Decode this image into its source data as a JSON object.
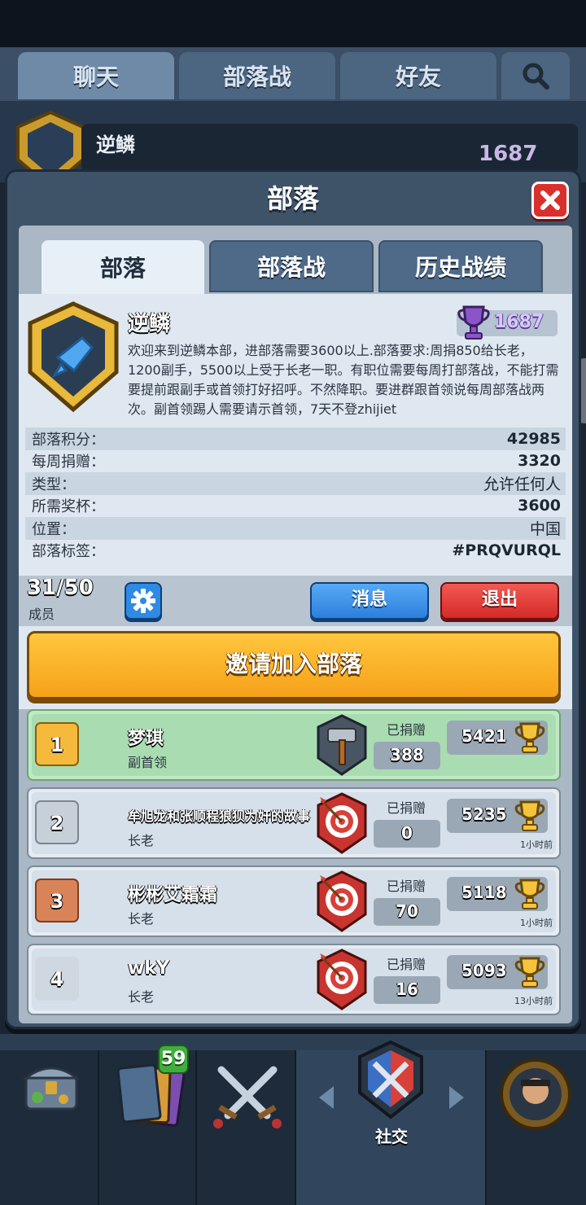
{
  "top_tabs": [
    "聊天",
    "部落战",
    "好友"
  ],
  "background_clan": {
    "name": "逆鳞",
    "trophies": "1687"
  },
  "modal": {
    "title": "部落",
    "tabs": [
      "部落",
      "部落战",
      "历史战绩"
    ],
    "clan": {
      "name": "逆鳞",
      "trophies": "1687",
      "description": "欢迎来到逆鳞本部，进部落需要3600以上.部落要求:周捐850给长老，1200副手，5500以上受于长老一职。有职位需要每周打部落战，不能打需要提前跟副手或首领打好招呼。不然降职。要进群跟首领说每周部落战两次。副首领踢人需要请示首领，7天不登zhijiet"
    },
    "stats": [
      {
        "label": "部落积分：",
        "value": "42985"
      },
      {
        "label": "每周捐赠：",
        "value": "3320"
      },
      {
        "label": "类型：",
        "value": "允许任何人"
      },
      {
        "label": "所需奖杯：",
        "value": "3600"
      },
      {
        "label": "位置：",
        "value": "中国"
      },
      {
        "label": "部落标签：",
        "value": "#PRQVURQL"
      }
    ],
    "members_count": "31/50",
    "members_label": "成员",
    "message_button": "消息",
    "leave_button": "退出",
    "invite_button": "邀请加入部落",
    "donated_label": "已捐赠",
    "members": [
      {
        "rank": "1",
        "name": "梦琪",
        "role": "副首领",
        "donated": "388",
        "trophies": "5421",
        "last_seen": ""
      },
      {
        "rank": "2",
        "name": "牟旭龙和张顺程狼狈为奸的故事",
        "role": "长老",
        "donated": "0",
        "trophies": "5235",
        "last_seen": "1小时前"
      },
      {
        "rank": "3",
        "name": "彬彬艾霜霜",
        "role": "长老",
        "donated": "70",
        "trophies": "5118",
        "last_seen": "1小时前"
      },
      {
        "rank": "4",
        "name": "wkY",
        "role": "长老",
        "donated": "16",
        "trophies": "5093",
        "last_seen": "13小时前"
      }
    ]
  },
  "bottom_nav": {
    "cards_badge": "59",
    "social_label": "社交"
  },
  "colors": {
    "accent_gold": "#f6a11a",
    "close_red": "#d9302d",
    "message_blue": "#2d7fdc",
    "trophy_purple": "#8a55c9"
  }
}
